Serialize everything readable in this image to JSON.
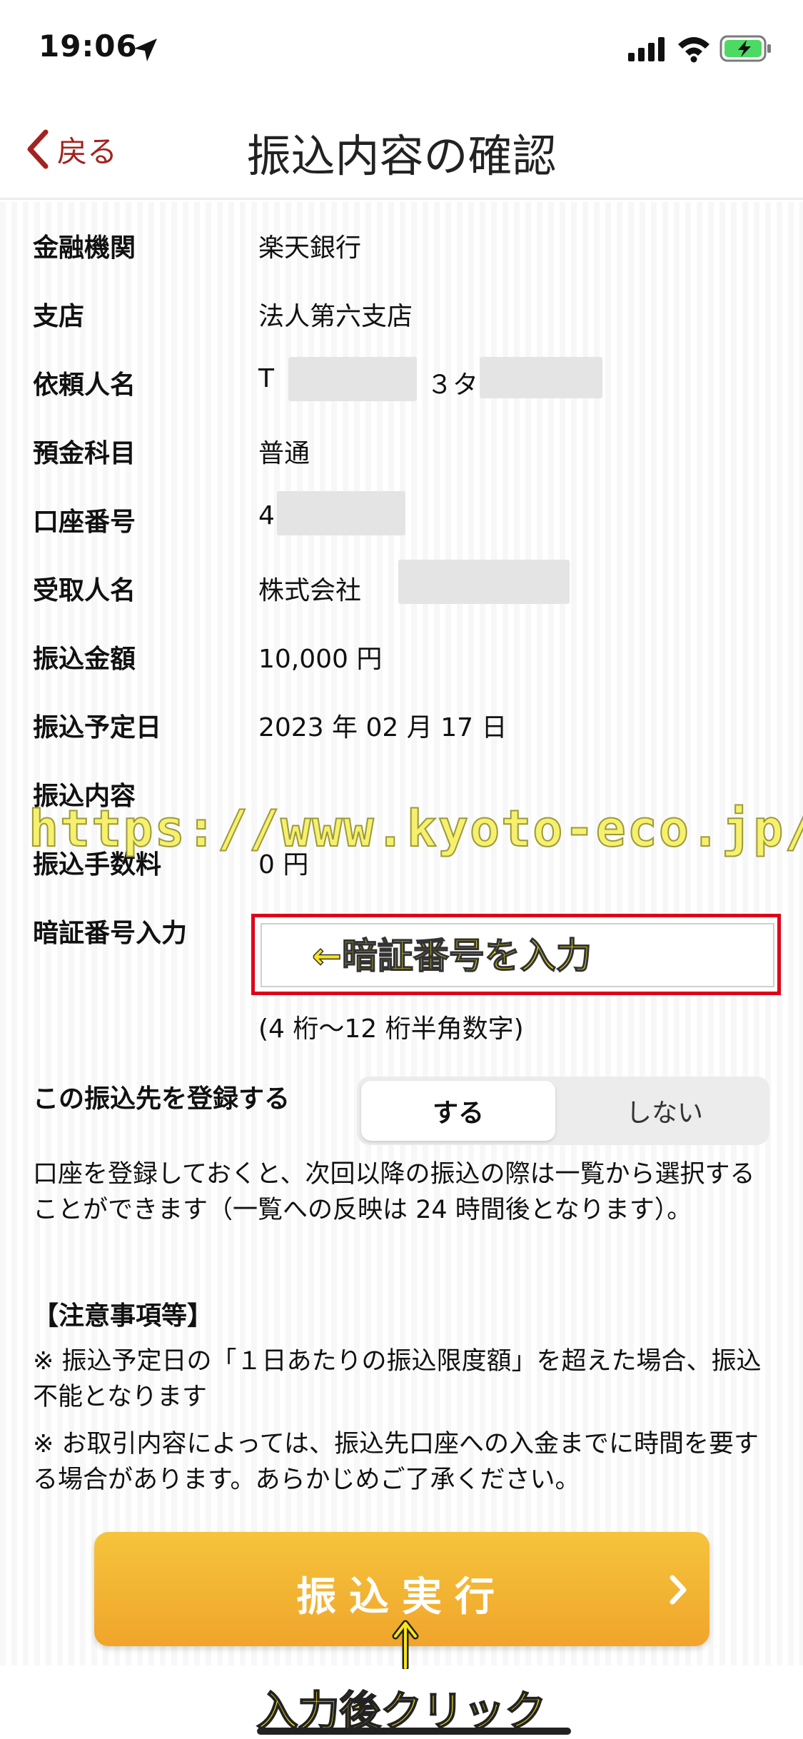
{
  "status_bar": {
    "time": "19:06"
  },
  "nav": {
    "back_label": "戻る",
    "title": "振込内容の確認"
  },
  "details": [
    {
      "label": "金融機関",
      "value": "楽天銀行"
    },
    {
      "label": "支店",
      "value": "法人第六支店"
    },
    {
      "label": "依頼人名",
      "value": "T",
      "value2": "３タ"
    },
    {
      "label": "預金科目",
      "value": "普通"
    },
    {
      "label": "口座番号",
      "value": "4"
    },
    {
      "label": "受取人名",
      "value": "株式会社"
    },
    {
      "label": "振込金額",
      "value": "10,000 円"
    },
    {
      "label": "振込予定日",
      "value": "2023 年 02 月 17 日"
    },
    {
      "label": "振込内容",
      "value": ""
    },
    {
      "label": "振込手数料",
      "value": "0 円"
    }
  ],
  "watermark": "https://www.kyoto-eco.jp/",
  "pin": {
    "label": "暗証番号入力",
    "annotation": "←暗証番号を入力",
    "hint": "(4 桁〜12 桁半角数字)"
  },
  "register": {
    "label": "この振込先を登録する",
    "option_on": "する",
    "option_off": "しない",
    "description": "口座を登録しておくと、次回以降の振込の際は一覧から選択することができます（一覧への反映は 24 時間後となります）。"
  },
  "notes": {
    "title": "【注意事項等】",
    "items": [
      "※ 振込予定日の「１日あたりの振込限度額」を超えた場合、振込不能となります",
      "※ お取引内容によっては、振込先口座への入金までに時間を要する場合があります。あらかじめご了承ください。"
    ]
  },
  "execute_button": {
    "label": "振込実行"
  },
  "annotation_footer": "入力後クリック",
  "colors": {
    "accent": "#a3231f",
    "button": "#f0a52b",
    "highlight": "#e0001b"
  }
}
